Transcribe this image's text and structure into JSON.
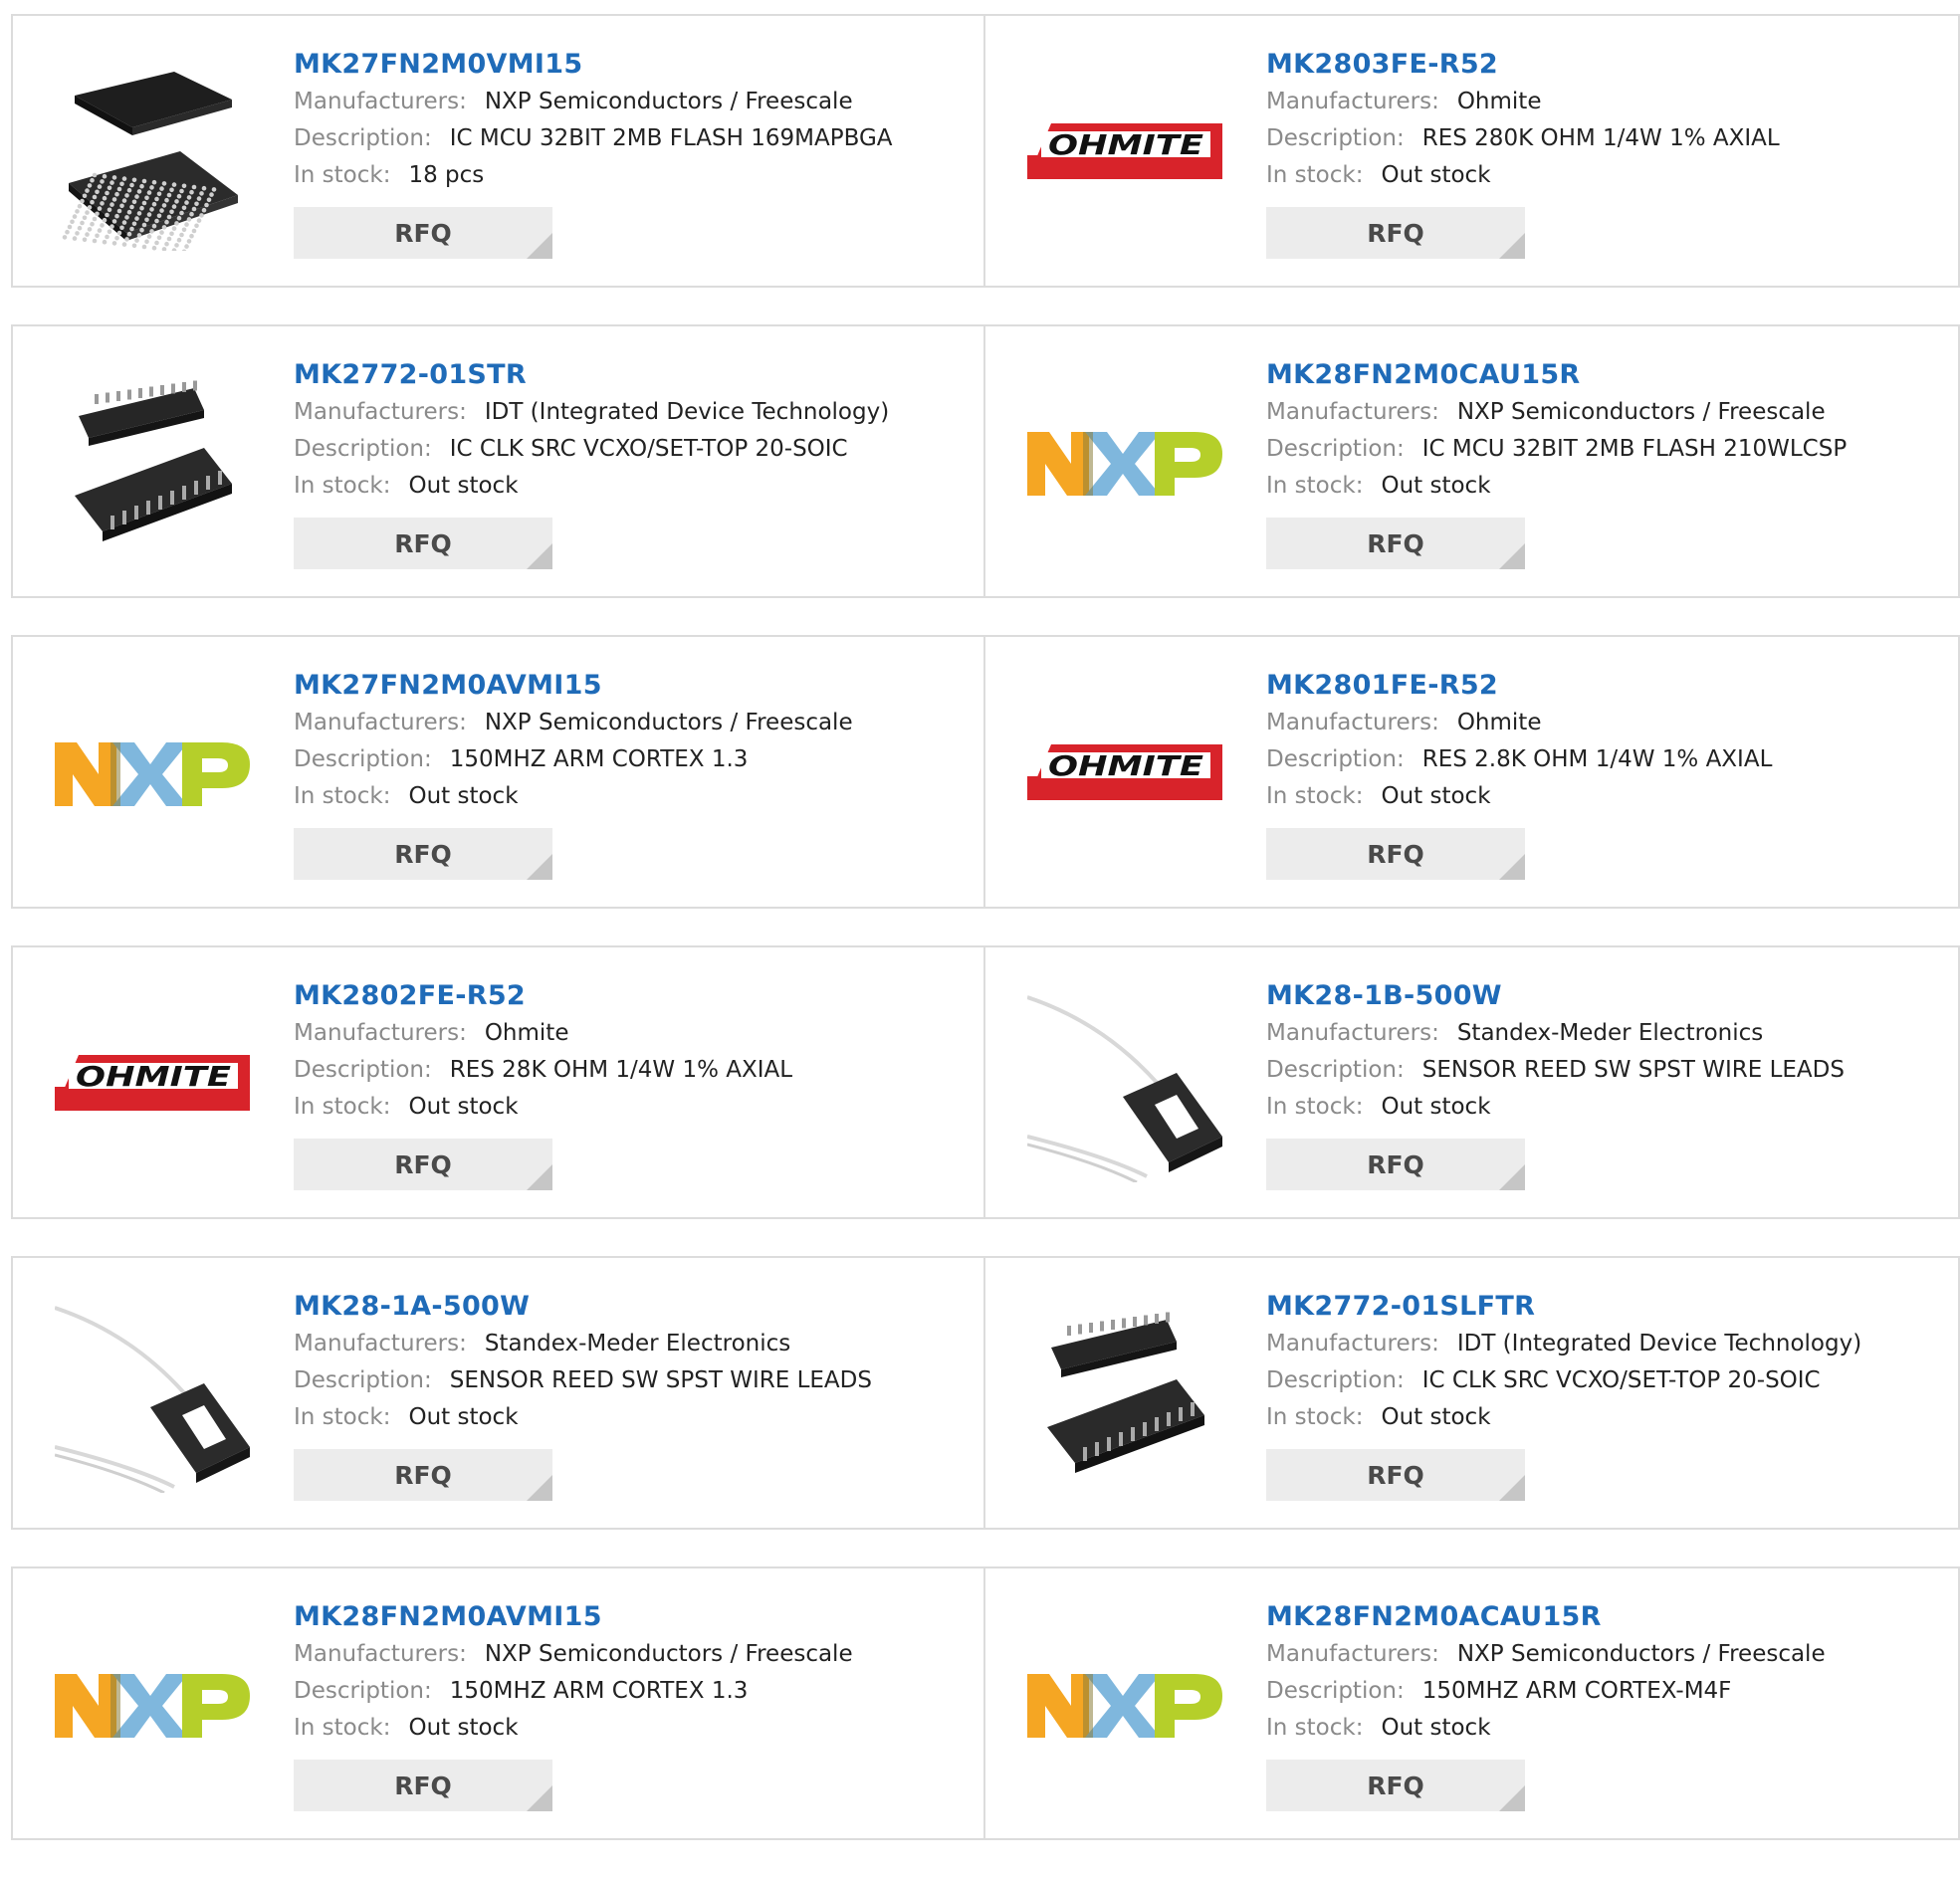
{
  "labels": {
    "manufacturers": "Manufacturers:",
    "description": "Description:",
    "in_stock": "In stock:",
    "rfq": "RFQ"
  },
  "brand_colors": {
    "link": "#1f6bb8",
    "nxp_orange": "#f5a623",
    "nxp_blue": "#7fb7dd",
    "nxp_green": "#b5cf2a",
    "ohmite_red": "#d8232a"
  },
  "products": [
    {
      "part": "MK27FN2M0VMI15",
      "manufacturer": "NXP Semiconductors / Freescale",
      "description": "IC MCU 32BIT 2MB FLASH 169MAPBGA",
      "stock": "18 pcs",
      "image": "bga-chip",
      "logo_text": ""
    },
    {
      "part": "MK2803FE-R52",
      "manufacturer": "Ohmite",
      "description": "RES 280K OHM 1/4W 1% AXIAL",
      "stock": "Out stock",
      "image": "ohmite-logo",
      "logo_text": "OHMITE"
    },
    {
      "part": "MK2772-01STR",
      "manufacturer": "IDT (Integrated Device Technology)",
      "description": "IC CLK SRC VCXO/SET-TOP 20-SOIC",
      "stock": "Out stock",
      "image": "soic-chip",
      "logo_text": ""
    },
    {
      "part": "MK28FN2M0CAU15R",
      "manufacturer": "NXP Semiconductors / Freescale",
      "description": "IC MCU 32BIT 2MB FLASH 210WLCSP",
      "stock": "Out stock",
      "image": "nxp-logo",
      "logo_text": ""
    },
    {
      "part": "MK27FN2M0AVMI15",
      "manufacturer": "NXP Semiconductors / Freescale",
      "description": "150MHZ ARM CORTEX 1.3",
      "stock": "Out stock",
      "image": "nxp-logo",
      "logo_text": ""
    },
    {
      "part": "MK2801FE-R52",
      "manufacturer": "Ohmite",
      "description": "RES 2.8K OHM 1/4W 1% AXIAL",
      "stock": "Out stock",
      "image": "ohmite-logo",
      "logo_text": "OHMITE"
    },
    {
      "part": "MK2802FE-R52",
      "manufacturer": "Ohmite",
      "description": "RES 28K OHM 1/4W 1% AXIAL",
      "stock": "Out stock",
      "image": "ohmite-logo",
      "logo_text": "OHMITE"
    },
    {
      "part": "MK28-1B-500W",
      "manufacturer": "Standex-Meder Electronics",
      "description": "SENSOR REED SW SPST WIRE LEADS",
      "stock": "Out stock",
      "image": "reed-sensor",
      "logo_text": ""
    },
    {
      "part": "MK28-1A-500W",
      "manufacturer": "Standex-Meder Electronics",
      "description": "SENSOR REED SW SPST WIRE LEADS",
      "stock": "Out stock",
      "image": "reed-sensor",
      "logo_text": ""
    },
    {
      "part": "MK2772-01SLFTR",
      "manufacturer": "IDT (Integrated Device Technology)",
      "description": "IC CLK SRC VCXO/SET-TOP 20-SOIC",
      "stock": "Out stock",
      "image": "soic-chip",
      "logo_text": ""
    },
    {
      "part": "MK28FN2M0AVMI15",
      "manufacturer": "NXP Semiconductors / Freescale",
      "description": "150MHZ ARM CORTEX 1.3",
      "stock": "Out stock",
      "image": "nxp-logo",
      "logo_text": ""
    },
    {
      "part": "MK28FN2M0ACAU15R",
      "manufacturer": "NXP Semiconductors / Freescale",
      "description": "150MHZ ARM CORTEX-M4F",
      "stock": "Out stock",
      "image": "nxp-logo",
      "logo_text": ""
    }
  ]
}
